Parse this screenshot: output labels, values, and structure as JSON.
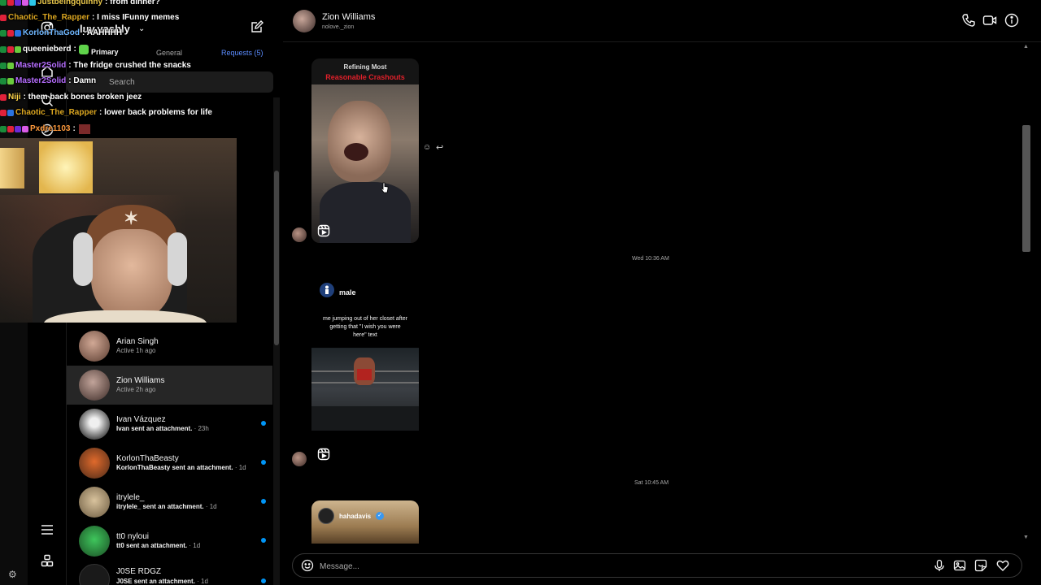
{
  "inbox": {
    "account_name": "luv.yashly",
    "tabs": [
      "Primary",
      "General",
      "Requests (5)"
    ],
    "search_placeholder": "Search",
    "conversations": [
      {
        "name": "Arian Singh",
        "sub": "Active 1h ago",
        "unread": false,
        "time": "",
        "color": "#b08878"
      },
      {
        "name": "Zion Williams",
        "sub": "Active 2h ago",
        "unread": false,
        "time": "",
        "color": "#a98a80"
      },
      {
        "name": "Ivan Vázquez",
        "sub": "Ivan sent an attachment.",
        "unread": true,
        "time": "· 23h",
        "color": "#d8d8d8"
      },
      {
        "name": "KorlonThaBeasty",
        "sub": "KorlonThaBeasty sent an attachment.",
        "unread": true,
        "time": "· 1d",
        "color": "#d0531c"
      },
      {
        "name": "itrylele_",
        "sub": "itrylele_ sent an attachment.",
        "unread": true,
        "time": "· 1d",
        "color": "#c6b08c"
      },
      {
        "name": "tt0 nyloui",
        "sub": "tt0 sent an attachment.",
        "unread": true,
        "time": "· 1d",
        "color": "#2fa84a"
      },
      {
        "name": "J0SE RDGZ",
        "sub": "J0SE sent an attachment.",
        "unread": true,
        "time": "· 1d",
        "color": "#222222"
      }
    ]
  },
  "chat": {
    "name": "Zion Williams",
    "username": "nolove._zion",
    "timestamps": [
      "Wed 10:36 AM",
      "Sat 10:45 AM"
    ],
    "post1": {
      "caption_top": "Refining Most",
      "caption_red": "Reasonable Crashouts"
    },
    "post2": {
      "author": "male",
      "caption": "me jumping out of her closet after getting that \"I wish you were here\" text"
    },
    "post3": {
      "author": "hahadavis"
    },
    "composer_placeholder": "Message..."
  },
  "stream_chat": [
    {
      "user": "Justbeingquinny",
      "msg": ": from dinner?",
      "color": "#e8c64a"
    },
    {
      "user": "Chaotic_The_Rapper",
      "msg": ": I miss IFunny memes",
      "color": "#daa520"
    },
    {
      "user": "KorlonThaGod",
      "msg": ": AAHHHH",
      "color": "#6fb7ff"
    },
    {
      "user": "queenieberd",
      "msg": ":",
      "color": "#ffffff"
    },
    {
      "user": "Master2Solid",
      "msg": ": The fridge crushed the snacks",
      "color": "#b66dff"
    },
    {
      "user": "Master2Solid",
      "msg": ": Damn",
      "color": "#b66dff"
    },
    {
      "user": "Niji",
      "msg": ": them back bones broken jeez",
      "color": "#ffd54a"
    },
    {
      "user": "Chaotic_The_Rapper",
      "msg": ": lower back problems for life",
      "color": "#daa520"
    },
    {
      "user": "Pxdre1103",
      "msg": ":",
      "color": "#ff9a3c"
    }
  ],
  "icons": {
    "nav": [
      "instagram-icon",
      "home-icon",
      "search-icon",
      "explore-icon",
      "menu-icon",
      "more-icon",
      "settings-icon"
    ],
    "header": [
      "phone-icon",
      "video-call-icon",
      "info-icon"
    ],
    "composer": [
      "emoji-icon",
      "microphone-icon",
      "image-icon",
      "sticker-icon",
      "heart-icon"
    ]
  }
}
